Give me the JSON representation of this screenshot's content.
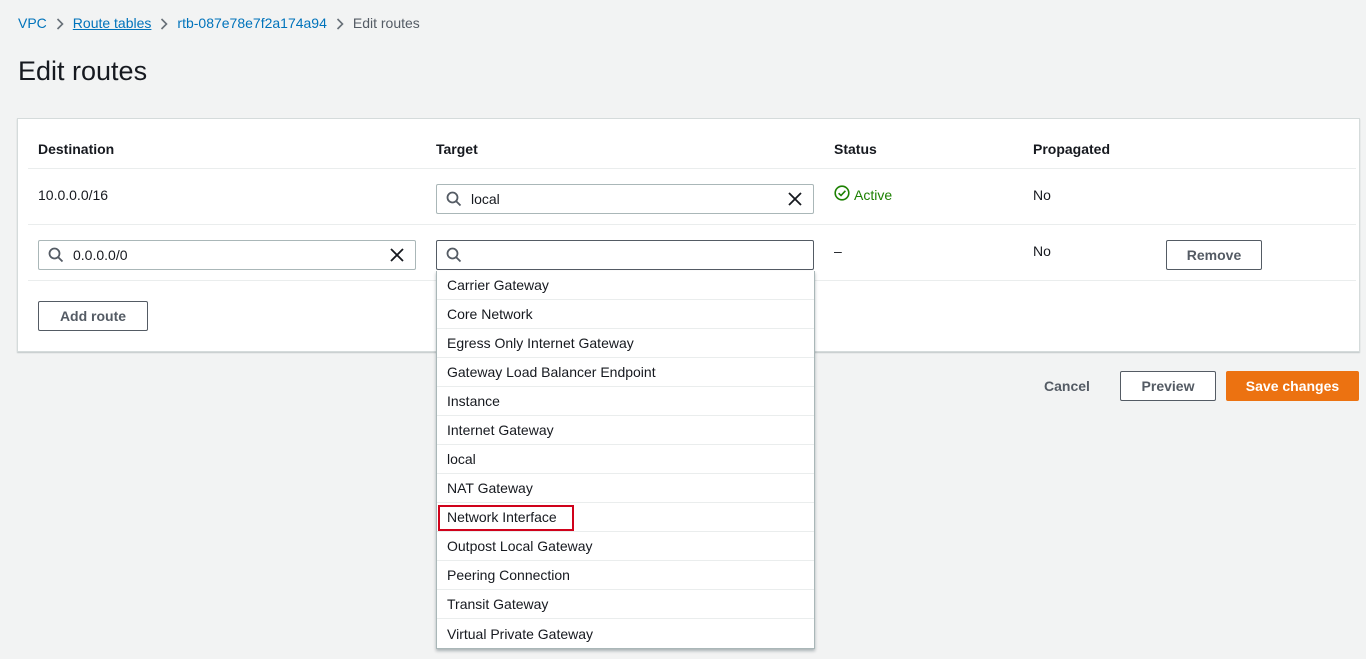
{
  "breadcrumb": {
    "items": [
      "VPC",
      "Route tables",
      "rtb-087e78e7f2a174a94"
    ],
    "current": "Edit routes"
  },
  "page_title": "Edit routes",
  "table": {
    "headers": {
      "destination": "Destination",
      "target": "Target",
      "status": "Status",
      "propagated": "Propagated"
    },
    "rows": [
      {
        "destination": "10.0.0.0/16",
        "target": "local",
        "status": "Active",
        "propagated": "No"
      },
      {
        "destination": "0.0.0.0/0",
        "target": "",
        "status": "–",
        "propagated": "No",
        "remove_label": "Remove"
      }
    ]
  },
  "add_route_label": "Add route",
  "target_dropdown": {
    "options": [
      "Carrier Gateway",
      "Core Network",
      "Egress Only Internet Gateway",
      "Gateway Load Balancer Endpoint",
      "Instance",
      "Internet Gateway",
      "local",
      "NAT Gateway",
      "Network Interface",
      "Outpost Local Gateway",
      "Peering Connection",
      "Transit Gateway",
      "Virtual Private Gateway"
    ],
    "highlighted": "Network Interface"
  },
  "footer": {
    "cancel_label": "Cancel",
    "preview_label": "Preview",
    "save_label": "Save changes"
  },
  "colors": {
    "link": "#0073bb",
    "primary": "#ec7211",
    "active_status": "#1d8102",
    "highlight_box": "#d0021b"
  },
  "icons": {
    "search": "search-icon",
    "clear": "close-icon",
    "status_ok": "check-circle-icon",
    "breadcrumb_sep": "chevron-right-icon"
  }
}
